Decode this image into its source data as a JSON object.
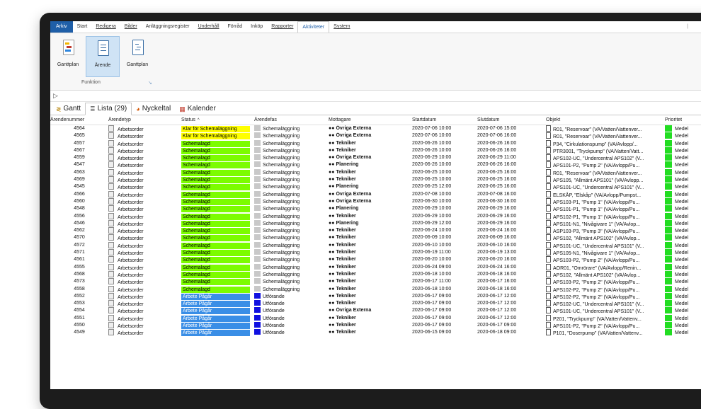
{
  "menu": {
    "items": [
      "Arkiv",
      "Start",
      "Redigera",
      "Bilder",
      "Anläggningsregister",
      "Underhåll",
      "Förråd",
      "Inköp",
      "Rapporter",
      "Aktiviteter",
      "System"
    ],
    "active": "Aktiviteter",
    "right_glyph": "|"
  },
  "ribbon": {
    "buttons": [
      {
        "label": "Ganttplan",
        "icon": "gantt-chart-icon",
        "selected": false
      },
      {
        "label": "Ärende",
        "icon": "document-icon",
        "selected": true
      },
      {
        "label": "Ganttplan",
        "icon": "document-gantt-icon",
        "selected": false
      }
    ],
    "group_label": "Funktion",
    "group_expand": "↘"
  },
  "toolbar": {
    "expand_glyph": "▷"
  },
  "tabs": [
    {
      "label": "Gantt",
      "icon": "gantt-icon",
      "glyph": "≷",
      "active": false
    },
    {
      "label": "Lista (29)",
      "icon": "list-icon",
      "glyph": "≣",
      "active": true
    },
    {
      "label": "Nyckeltal",
      "icon": "pie-chart-icon",
      "glyph": "◕",
      "active": false
    },
    {
      "label": "Kalender",
      "icon": "calendar-icon",
      "glyph": "▦",
      "active": false
    }
  ],
  "columns": {
    "num": "Ärendenummer",
    "type": "Ärendetyp",
    "status": "Status",
    "phase": "Ärendefas",
    "receiver": "Mottagare",
    "start": "Startdatum",
    "end": "Slutdatum",
    "object": "Objekt",
    "priority": "Prioritet",
    "sort_glyph": "^"
  },
  "colors": {
    "yellow": "#ffff00",
    "green": "#7cfc00",
    "blue": "#3a8ee6",
    "phase_grey": "#c8c8c8",
    "phase_blue": "#1010e0",
    "prio_green": "#22dd22"
  },
  "rows": [
    {
      "num": "4564",
      "type": "Arbetsorder",
      "status": "Klar för Schemaläggning",
      "sc": "yellow",
      "phase": "Schemaläggning",
      "pc": "grey",
      "receiver": "Övriga Externa",
      "start": "2020-07-06 10:00",
      "end": "2020-07-06 15:00",
      "object": "R01, \"Reservoar\" (VA/Vatten/Vattenver...",
      "priority": "Medel"
    },
    {
      "num": "4565",
      "type": "Arbetsorder",
      "status": "Klar för Schemaläggning",
      "sc": "yellow",
      "phase": "Schemaläggning",
      "pc": "grey",
      "receiver": "Övriga Externa",
      "start": "2020-07-06 10:00",
      "end": "2020-07-06 16:00",
      "object": "R01, \"Reservoar\" (VA/Vatten/Vattenver...",
      "priority": "Medel"
    },
    {
      "num": "4557",
      "type": "Arbetsorder",
      "status": "Schemalagd",
      "sc": "green",
      "phase": "Schemaläggning",
      "pc": "grey",
      "receiver": "Tekniker",
      "start": "2020-06-26 10:00",
      "end": "2020-06-26 16:00",
      "object": "P34, \"Cirkulationspump\" (VA/Avlopp/...",
      "priority": "Medel"
    },
    {
      "num": "4567",
      "type": "Arbetsorder",
      "status": "Schemalagd",
      "sc": "green",
      "phase": "Schemaläggning",
      "pc": "grey",
      "receiver": "Tekniker",
      "start": "2020-06-26 10:00",
      "end": "2020-06-26 16:00",
      "object": "PTR3001, \"Tryckpump\" (VA/Vatten/Vatt...",
      "priority": "Medel"
    },
    {
      "num": "4559",
      "type": "Arbetsorder",
      "status": "Schemalagd",
      "sc": "green",
      "phase": "Schemaläggning",
      "pc": "grey",
      "receiver": "Övriga Externa",
      "start": "2020-06-29 10:00",
      "end": "2020-06-29 11:00",
      "object": "APS102-UC, \"Undercentral APS102\" (V...",
      "priority": "Medel"
    },
    {
      "num": "4547",
      "type": "Arbetsorder",
      "status": "Schemalagd",
      "sc": "green",
      "phase": "Schemaläggning",
      "pc": "grey",
      "receiver": "Planering",
      "start": "2020-06-26 10:00",
      "end": "2020-06-26 16:00",
      "object": "APS101-P2, \"Pump 2\" (VA/Avlopp/Pu...",
      "priority": "Medel"
    },
    {
      "num": "4563",
      "type": "Arbetsorder",
      "status": "Schemalagd",
      "sc": "green",
      "phase": "Schemaläggning",
      "pc": "grey",
      "receiver": "Tekniker",
      "start": "2020-06-25 10:00",
      "end": "2020-06-25 16:00",
      "object": "R01, \"Reservoar\" (VA/Vatten/Vattenver...",
      "priority": "Medel"
    },
    {
      "num": "4569",
      "type": "Arbetsorder",
      "status": "Schemalagd",
      "sc": "green",
      "phase": "Schemaläggning",
      "pc": "grey",
      "receiver": "Tekniker",
      "start": "2020-06-25 10:00",
      "end": "2020-06-25 16:00",
      "object": "APS105, \"Allmänt APS101\" (VA/Avlopp...",
      "priority": "Medel"
    },
    {
      "num": "4545",
      "type": "Arbetsorder",
      "status": "Schemalagd",
      "sc": "green",
      "phase": "Schemaläggning",
      "pc": "grey",
      "receiver": "Planering",
      "start": "2020-06-25 12:00",
      "end": "2020-06-25 16:00",
      "object": "APS101-UC, \"Undercentral APS101\" (V...",
      "priority": "Medel"
    },
    {
      "num": "4566",
      "type": "Arbetsorder",
      "status": "Schemalagd",
      "sc": "green",
      "phase": "Schemaläggning",
      "pc": "grey",
      "receiver": "Övriga Externa",
      "start": "2020-07-08 10:00",
      "end": "2020-07-08 16:00",
      "object": "ELSKÅP, \"Elskåp\" (VA/Avlopp/Pumpst...",
      "priority": "Medel"
    },
    {
      "num": "4560",
      "type": "Arbetsorder",
      "status": "Schemalagd",
      "sc": "green",
      "phase": "Schemaläggning",
      "pc": "grey",
      "receiver": "Övriga Externa",
      "start": "2020-06-30 10:00",
      "end": "2020-06-30 16:00",
      "object": "APS103-P1, \"Pump 1\" (VA/Avlopp/Pu...",
      "priority": "Medel"
    },
    {
      "num": "4548",
      "type": "Arbetsorder",
      "status": "Schemalagd",
      "sc": "green",
      "phase": "Schemaläggning",
      "pc": "grey",
      "receiver": "Planering",
      "start": "2020-06-29 10:00",
      "end": "2020-06-29 16:00",
      "object": "APS101-P1, \"Pump 1\" (VA/Avlopp/Pu...",
      "priority": "Medel"
    },
    {
      "num": "4556",
      "type": "Arbetsorder",
      "status": "Schemalagd",
      "sc": "green",
      "phase": "Schemaläggning",
      "pc": "grey",
      "receiver": "Tekniker",
      "start": "2020-06-29 10:00",
      "end": "2020-06-29 16:00",
      "object": "APS102-P1, \"Pump 1\" (VA/Avlopp/Pu...",
      "priority": "Medel"
    },
    {
      "num": "4546",
      "type": "Arbetsorder",
      "status": "Schemalagd",
      "sc": "green",
      "phase": "Schemaläggning",
      "pc": "grey",
      "receiver": "Planering",
      "start": "2020-06-29 12:00",
      "end": "2020-06-29 16:00",
      "object": "APS101-N1, \"Nivågivare 1\" (VA/Avlop...",
      "priority": "Medel"
    },
    {
      "num": "4562",
      "type": "Arbetsorder",
      "status": "Schemalagd",
      "sc": "green",
      "phase": "Schemaläggning",
      "pc": "grey",
      "receiver": "Tekniker",
      "start": "2020-06-24 10:00",
      "end": "2020-06-24 16:00",
      "object": "ASP103-P3, \"Pump 3\" (VA/Avlopp/Pu...",
      "priority": "Medel"
    },
    {
      "num": "4570",
      "type": "Arbetsorder",
      "status": "Schemalagd",
      "sc": "green",
      "phase": "Schemaläggning",
      "pc": "grey",
      "receiver": "Tekniker",
      "start": "2020-06-09 10:00",
      "end": "2020-06-09 16:00",
      "object": "APS102, \"Allmänt APS102\" (VA/Avlop...",
      "priority": "Medel"
    },
    {
      "num": "4572",
      "type": "Arbetsorder",
      "status": "Schemalagd",
      "sc": "green",
      "phase": "Schemaläggning",
      "pc": "grey",
      "receiver": "Tekniker",
      "start": "2020-06-10 10:00",
      "end": "2020-06-10 16:00",
      "object": "APS101-UC, \"Undercentral APS101\" (V...",
      "priority": "Medel"
    },
    {
      "num": "4571",
      "type": "Arbetsorder",
      "status": "Schemalagd",
      "sc": "green",
      "phase": "Schemaläggning",
      "pc": "grey",
      "receiver": "Tekniker",
      "start": "2020-06-19 11:00",
      "end": "2020-06-19 13:00",
      "object": "APS105-N1, \"Nivågivare 1\" (VA/Avlop...",
      "priority": "Medel"
    },
    {
      "num": "4561",
      "type": "Arbetsorder",
      "status": "Schemalagd",
      "sc": "green",
      "phase": "Schemaläggning",
      "pc": "grey",
      "receiver": "Tekniker",
      "start": "2020-06-20 10:00",
      "end": "2020-06-20 16:00",
      "object": "APS103-P2, \"Pump 2\" (VA/Avlopp/Pu...",
      "priority": "Medel"
    },
    {
      "num": "4555",
      "type": "Arbetsorder",
      "status": "Schemalagd",
      "sc": "green",
      "phase": "Schemaläggning",
      "pc": "grey",
      "receiver": "Tekniker",
      "start": "2020-06-24 09:00",
      "end": "2020-06-24 16:00",
      "object": "AOR01, \"Omrörare\" (VA/Avlopp/Renin...",
      "priority": "Medel"
    },
    {
      "num": "4568",
      "type": "Arbetsorder",
      "status": "Schemalagd",
      "sc": "green",
      "phase": "Schemaläggning",
      "pc": "grey",
      "receiver": "Tekniker",
      "start": "2020-06-18 10:00",
      "end": "2020-06-18 16:00",
      "object": "APS102, \"Allmänt APS102\" (VA/Avlop...",
      "priority": "Medel"
    },
    {
      "num": "4573",
      "type": "Arbetsorder",
      "status": "Schemalagd",
      "sc": "green",
      "phase": "Schemaläggning",
      "pc": "grey",
      "receiver": "Tekniker",
      "start": "2020-06-17 11:00",
      "end": "2020-06-17 16:00",
      "object": "APS103-P2, \"Pump 2\" (VA/Avlopp/Pu...",
      "priority": "Medel"
    },
    {
      "num": "4558",
      "type": "Arbetsorder",
      "status": "Schemalagd",
      "sc": "green",
      "phase": "Schemaläggning",
      "pc": "grey",
      "receiver": "Tekniker",
      "start": "2020-06-18 10:00",
      "end": "2020-06-18 16:00",
      "object": "APS102-P2, \"Pump 2\" (VA/Avlopp/Pu...",
      "priority": "Medel"
    },
    {
      "num": "4552",
      "type": "Arbetsorder",
      "status": "Arbete Pågår",
      "sc": "blue",
      "phase": "Utförande",
      "pc": "blue",
      "receiver": "Tekniker",
      "start": "2020-06-17 09:00",
      "end": "2020-06-17 12:00",
      "object": "APS102-P2, \"Pump 2\" (VA/Avlopp/Pu...",
      "priority": "Medel"
    },
    {
      "num": "4553",
      "type": "Arbetsorder",
      "status": "Arbete Pågår",
      "sc": "blue",
      "phase": "Utförande",
      "pc": "blue",
      "receiver": "Tekniker",
      "start": "2020-06-17 09:00",
      "end": "2020-06-17 12:00",
      "object": "APS102-UC, \"Undercentral APS101\" (V...",
      "priority": "Medel"
    },
    {
      "num": "4554",
      "type": "Arbetsorder",
      "status": "Arbete Pågår",
      "sc": "blue",
      "phase": "Utförande",
      "pc": "blue",
      "receiver": "Övriga Externa",
      "start": "2020-06-17 09:00",
      "end": "2020-06-17 12:00",
      "object": "APS101-UC, \"Undercentral APS101\" (V...",
      "priority": "Medel"
    },
    {
      "num": "4551",
      "type": "Arbetsorder",
      "status": "Arbete Pågår",
      "sc": "blue",
      "phase": "Utförande",
      "pc": "blue",
      "receiver": "Tekniker",
      "start": "2020-06-17 09:00",
      "end": "2020-06-17 12:00",
      "object": "P201, \"Tryckpump\" (VA/Vatten/Vattenv...",
      "priority": "Medel"
    },
    {
      "num": "4550",
      "type": "Arbetsorder",
      "status": "Arbete Pågår",
      "sc": "blue",
      "phase": "Utförande",
      "pc": "blue",
      "receiver": "Tekniker",
      "start": "2020-06-17 09:00",
      "end": "2020-06-17 09:00",
      "object": "APS101-P2, \"Pump 2\" (VA/Avlopp/Pu...",
      "priority": "Medel"
    },
    {
      "num": "4549",
      "type": "Arbetsorder",
      "status": "Arbete Pågår",
      "sc": "blue",
      "phase": "Utförande",
      "pc": "blue",
      "receiver": "Tekniker",
      "start": "2020-06-15 09:00",
      "end": "2020-06-18 09:00",
      "object": "P101, \"Doserpump\" (VA/Vatten/Vattenv...",
      "priority": "Medel"
    }
  ]
}
